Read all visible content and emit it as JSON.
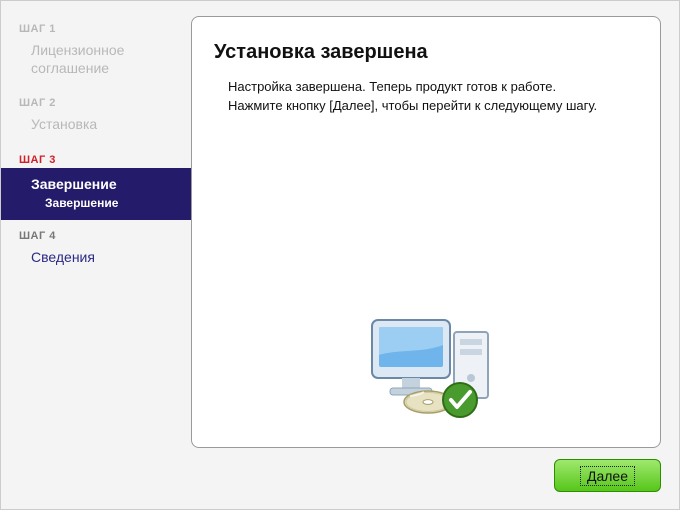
{
  "sidebar": {
    "steps": [
      {
        "label": "ШАГ 1",
        "title": "Лицензионное соглашение"
      },
      {
        "label": "ШАГ 2",
        "title": "Установка"
      },
      {
        "label": "ШАГ 3",
        "title": "Завершение",
        "sub": "Завершение"
      },
      {
        "label": "ШАГ 4",
        "title": "Сведения"
      }
    ]
  },
  "main": {
    "heading": "Установка завершена",
    "body_line1": "Настройка завершена. Теперь продукт готов к работе.",
    "body_line2": "Нажмите кнопку [Далее], чтобы перейти к следующему шагу."
  },
  "buttons": {
    "next": "Далее"
  }
}
